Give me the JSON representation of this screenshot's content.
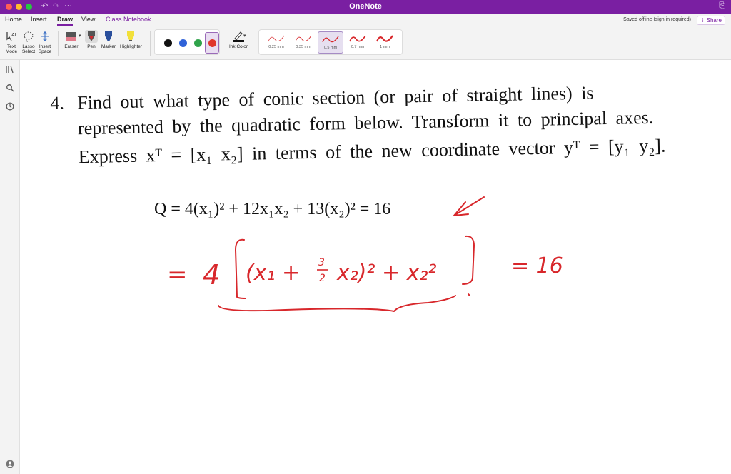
{
  "app": {
    "title": "OneNote",
    "more": "···"
  },
  "tabs": [
    {
      "label": "Home"
    },
    {
      "label": "Insert"
    },
    {
      "label": "Draw",
      "active": true
    },
    {
      "label": "View"
    },
    {
      "label": "Class Notebook"
    }
  ],
  "status": {
    "saved": "Saved offline (sign in required)",
    "share": "Share"
  },
  "ribbon": {
    "text_mode": "Text Mode",
    "lasso_select": "Lasso Select",
    "insert_space": "Insert Space",
    "eraser": "Eraser",
    "pen": "Pen",
    "marker": "Marker",
    "highlighter": "Highlighter",
    "ink_color": "Ink Color",
    "colors": [
      "#111111",
      "#2f62d8",
      "#2fa34a",
      "#e0362c"
    ],
    "selected_color": "#e0362c",
    "strokes": [
      "0.25 mm",
      "0.35 mm",
      "0.5 mm",
      "0.7 mm",
      "1 mm"
    ],
    "selected_stroke": "0.5 mm"
  },
  "rail": {
    "icons": [
      "notebooks-icon",
      "search-icon",
      "recent-icon",
      "account-icon"
    ]
  },
  "problem": {
    "number": "4.",
    "line1": "Find out what type of conic section (or pair of straight lines) is",
    "line2": "represented by the quadratic form below.  Transform it to principal axes.",
    "line3": "Express xᵀ = [x₁   x₂] in terms of the new coordinate vector yᵀ = [y₁   y₂]."
  },
  "equation": "Q = 4(x₁)² + 12x₁x₂ + 13(x₂)² = 16",
  "handwriting": {
    "ink_color": "#d8272b",
    "eq_lead": "=",
    "factor": "4",
    "term1": "(x₁ +",
    "frac_num": "3",
    "frac_den": "2",
    "term2": "x₂)²  +  x₂²",
    "rhs": "= 16"
  }
}
